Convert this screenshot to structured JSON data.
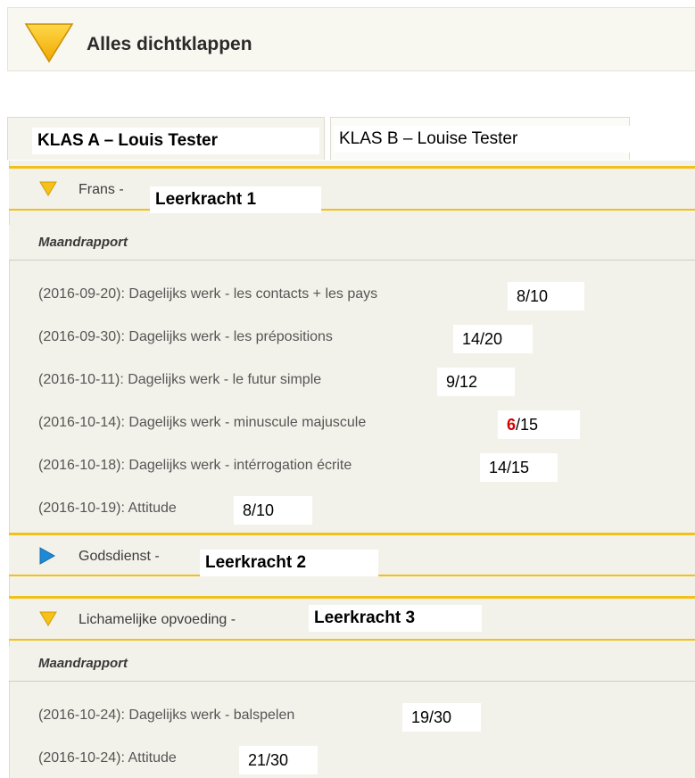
{
  "header": {
    "collapse_all_label": "Alles dichtklappen"
  },
  "tabs": [
    {
      "label": "KLAS A – Louis Tester"
    },
    {
      "label": "KLAS B – Louise Tester"
    }
  ],
  "subjects": [
    {
      "name": "Frans - ",
      "teacher": "Leerkracht 1",
      "expanded": true,
      "report_title": "Maandrapport",
      "rows": [
        {
          "text": "(2016-09-20): Dagelijks werk - les contacts + les pays",
          "score": "8/10"
        },
        {
          "text": "(2016-09-30): Dagelijks werk - les prépositions",
          "score": "14/20"
        },
        {
          "text": "(2016-10-11): Dagelijks werk - le futur simple",
          "score": "9/12"
        },
        {
          "text": "(2016-10-14): Dagelijks werk - minuscule majuscule",
          "score_highlight": "6",
          "score_rest": "/15"
        },
        {
          "text": "(2016-10-18): Dagelijks werk - intérrogation écrite",
          "score": "14/15"
        },
        {
          "text": "(2016-10-19): Attitude",
          "score": "8/10"
        }
      ]
    },
    {
      "name": "Godsdienst - ",
      "teacher": "Leerkracht 2",
      "expanded": false
    },
    {
      "name": "Lichamelijke opvoeding - ",
      "teacher": "Leerkracht 3",
      "expanded": true,
      "report_title": "Maandrapport",
      "rows": [
        {
          "text": "(2016-10-24): Dagelijks werk - balspelen",
          "score": "19/30"
        },
        {
          "text": "(2016-10-24): Attitude",
          "score": "21/30"
        }
      ]
    }
  ],
  "colors": {
    "accent_yellow": "#f2c01a",
    "expanded_icon": "#f5c21b",
    "collapsed_icon": "#1e8ad6",
    "low_score_red": "#d40000"
  },
  "icons": {
    "collapse_all": "triangle-down-icon",
    "expanded": "triangle-down-icon",
    "collapsed": "triangle-right-icon"
  }
}
